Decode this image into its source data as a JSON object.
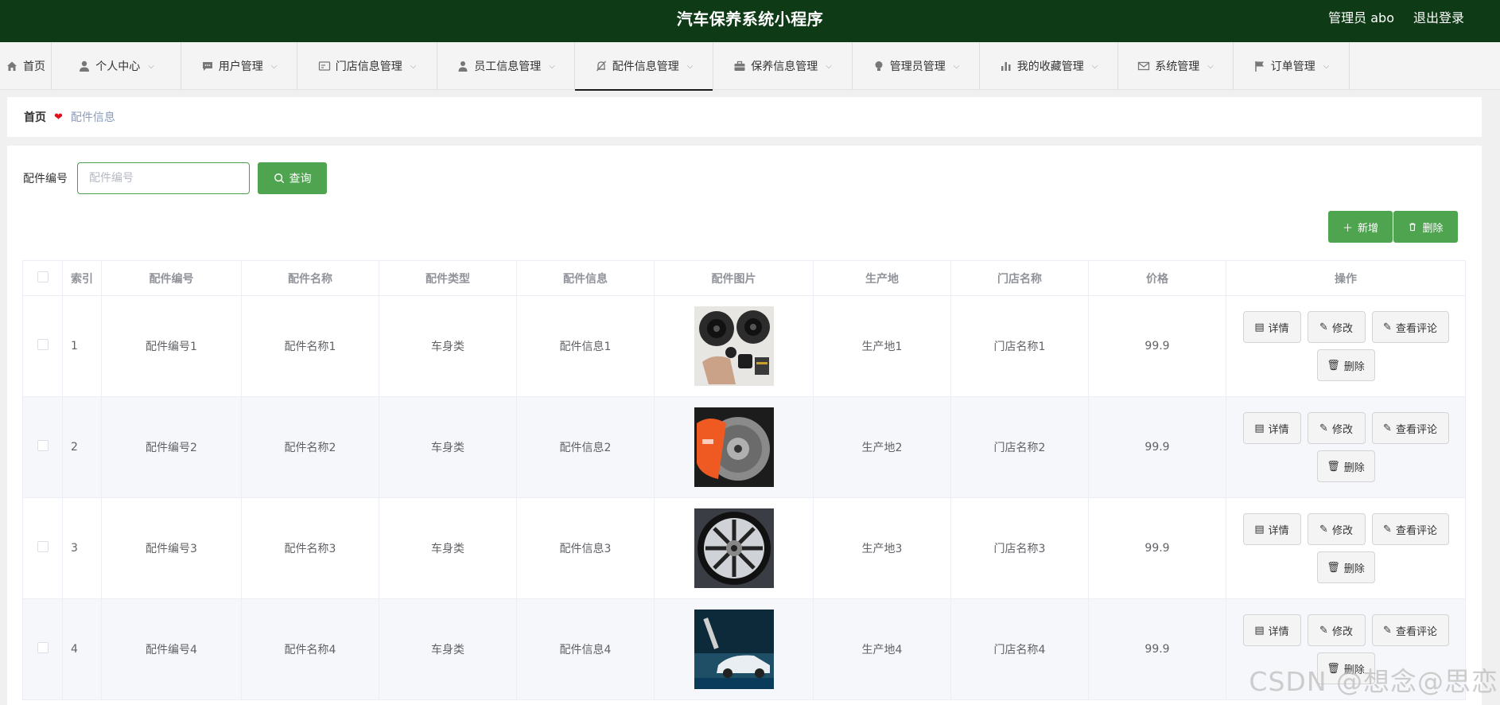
{
  "header": {
    "title": "汽车保养系统小程序",
    "admin_label": "管理员 abo",
    "logout_label": "退出登录",
    "bg_color": "#0f3a16"
  },
  "nav": {
    "items": [
      {
        "label": "首页",
        "icon": "home-icon"
      },
      {
        "label": "个人中心",
        "icon": "user-icon"
      },
      {
        "label": "用户管理",
        "icon": "chat-icon"
      },
      {
        "label": "门店信息管理",
        "icon": "card-icon"
      },
      {
        "label": "员工信息管理",
        "icon": "person-icon"
      },
      {
        "label": "配件信息管理",
        "icon": "bell-off-icon"
      },
      {
        "label": "保养信息管理",
        "icon": "briefcase-icon"
      },
      {
        "label": "管理员管理",
        "icon": "bulb-icon"
      },
      {
        "label": "我的收藏管理",
        "icon": "bar-chart-icon"
      },
      {
        "label": "系统管理",
        "icon": "mail-icon"
      },
      {
        "label": "订单管理",
        "icon": "flag-icon"
      }
    ],
    "active_index": 5
  },
  "breadcrumb": {
    "home": "首页",
    "current": "配件信息"
  },
  "search": {
    "label": "配件编号",
    "placeholder": "配件编号",
    "value": "",
    "button_label": "查询"
  },
  "actions": {
    "add_label": "新增",
    "delete_label": "删除"
  },
  "table": {
    "headers": [
      "索引",
      "配件编号",
      "配件名称",
      "配件类型",
      "配件信息",
      "配件图片",
      "生产地",
      "门店名称",
      "价格",
      "操作"
    ],
    "rows": [
      {
        "index": "1",
        "code": "配件编号1",
        "name": "配件名称1",
        "type": "车身类",
        "info": "配件信息1",
        "origin": "生产地1",
        "store": "门店名称1",
        "price": "99.9"
      },
      {
        "index": "2",
        "code": "配件编号2",
        "name": "配件名称2",
        "type": "车身类",
        "info": "配件信息2",
        "origin": "生产地2",
        "store": "门店名称2",
        "price": "99.9"
      },
      {
        "index": "3",
        "code": "配件编号3",
        "name": "配件名称3",
        "type": "车身类",
        "info": "配件信息3",
        "origin": "生产地3",
        "store": "门店名称3",
        "price": "99.9"
      },
      {
        "index": "4",
        "code": "配件编号4",
        "name": "配件名称4",
        "type": "车身类",
        "info": "配件信息4",
        "origin": "生产地4",
        "store": "门店名称4",
        "price": "99.9"
      }
    ],
    "row_ops": {
      "detail": "详情",
      "edit": "修改",
      "review": "查看评论",
      "delete": "删除"
    }
  },
  "watermark": "CSDN @想念@思恋",
  "colors": {
    "accent_green": "#4ea44f",
    "breadcrumb_heart": "#e0101a"
  }
}
